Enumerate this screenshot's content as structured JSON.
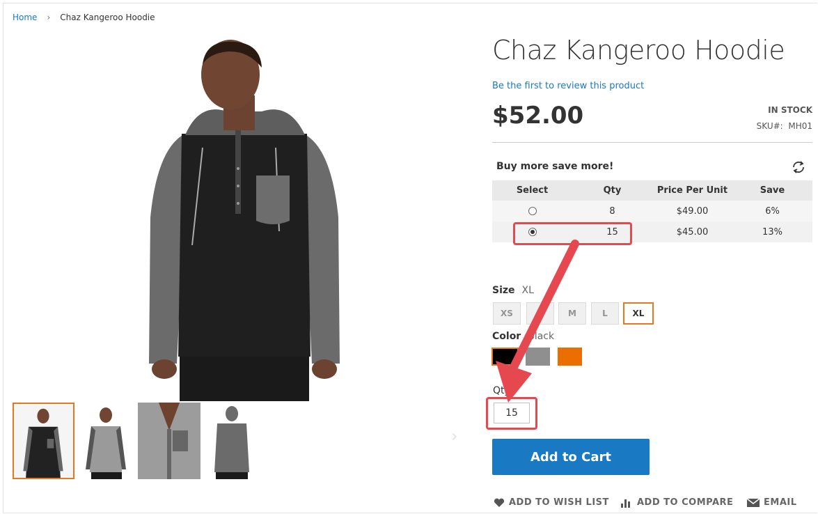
{
  "breadcrumb": {
    "home": "Home",
    "separator": "›",
    "current": "Chaz Kangeroo Hoodie"
  },
  "product": {
    "title": "Chaz Kangeroo Hoodie",
    "review_link": "Be the first to review this product",
    "price": "$52.00",
    "stock": "IN STOCK",
    "sku_label": "SKU#:",
    "sku": "MH01"
  },
  "gallery": {
    "next_arrow_icon": "chevron-right-icon",
    "thumbnails": [
      "thumbnail-1",
      "thumbnail-2",
      "thumbnail-3",
      "thumbnail-4"
    ],
    "active_index": 0
  },
  "tier_pricing": {
    "title": "Buy more save more!",
    "refresh_icon": "refresh-icon",
    "headers": [
      "Select",
      "Qty",
      "Price Per Unit",
      "Save"
    ],
    "rows": [
      {
        "selected": false,
        "qty": "8",
        "price": "$49.00",
        "save": "6%"
      },
      {
        "selected": true,
        "qty": "15",
        "price": "$45.00",
        "save": "13%"
      }
    ]
  },
  "options": {
    "size_label": "Size",
    "size_value": "XL",
    "sizes": [
      "XS",
      "S",
      "M",
      "L",
      "XL"
    ],
    "selected_size": "XL",
    "color_label": "Color",
    "color_value": "Black",
    "colors": [
      {
        "name": "Black",
        "hex": "#000000",
        "selected": true
      },
      {
        "name": "Gray",
        "hex": "#8f8f8f",
        "selected": false
      },
      {
        "name": "Orange",
        "hex": "#eb6f00",
        "selected": false
      }
    ]
  },
  "qty": {
    "label": "Qty",
    "value": "15"
  },
  "cart": {
    "button_label": "Add to Cart"
  },
  "actions": {
    "wishlist": "ADD TO WISH LIST",
    "compare": "ADD TO COMPARE",
    "email": "EMAIL"
  },
  "colors": {
    "accent": "#1979c3",
    "selected_outline": "#e87722",
    "annotation_red": "#e64850"
  }
}
